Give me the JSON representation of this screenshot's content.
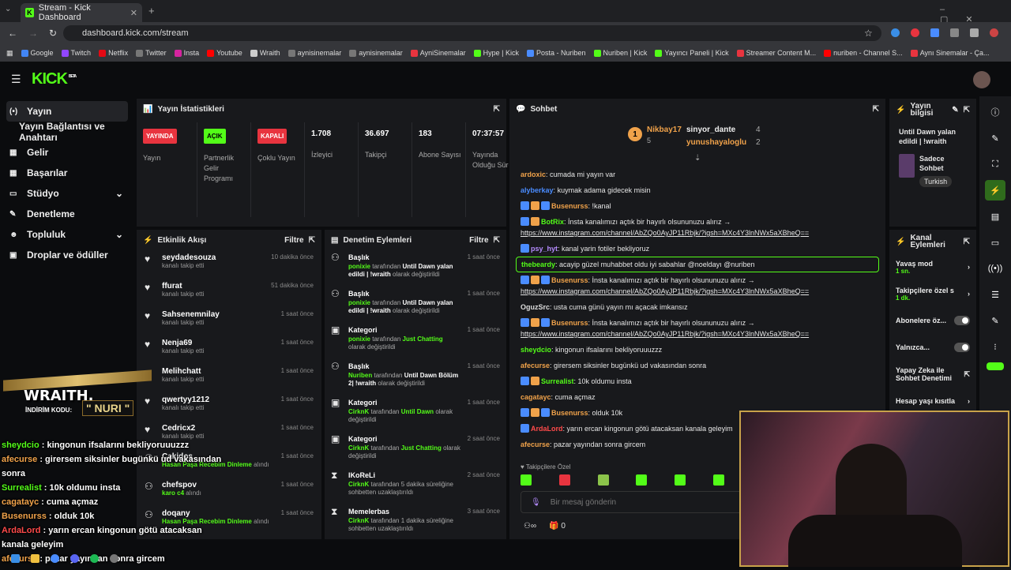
{
  "browser": {
    "tab_title": "Stream - Kick Dashboard",
    "url": "dashboard.kick.com/stream"
  },
  "bookmarks": [
    "Google",
    "Twitch",
    "Netflix",
    "Twitter",
    "Insta",
    "Youtube",
    "Wraith",
    "aynisinemalar",
    "aynisinemalar",
    "AyniSinemalar",
    "Hype | Kick",
    "Posta - Nuriben",
    "Nuriben | Kick",
    "Yayıncı Paneli | Kick",
    "Streamer Content M...",
    "nuriben - Channel S...",
    "Aynı Sinemalar - Ça..."
  ],
  "logo": "KICK",
  "logo_beta": "BETA",
  "sidebar": {
    "items": [
      {
        "label": "Yayın",
        "icon": "(•)"
      },
      {
        "label": "Yayın Bağlantısı ve Anahtarı",
        "icon": ""
      },
      {
        "label": "Gelir",
        "icon": "▦"
      },
      {
        "label": "Başarılar",
        "icon": "▦"
      },
      {
        "label": "Stüdyo",
        "icon": "▭"
      },
      {
        "label": "Denetleme",
        "icon": "✎"
      },
      {
        "label": "Topluluk",
        "icon": "☻"
      },
      {
        "label": "Droplar ve ödüller",
        "icon": "▣"
      }
    ]
  },
  "stats": {
    "title": "Yayın İstatistikleri",
    "cols": [
      {
        "badge": "YAYINDA",
        "label": "Yayın"
      },
      {
        "badge": "AÇIK",
        "label": "Partnerlik Gelir Programı"
      },
      {
        "badge": "KAPALI",
        "label": "Çoklu Yayın"
      },
      {
        "value": "1.708",
        "label": "İzleyici"
      },
      {
        "value": "36.697",
        "label": "Takipçi"
      },
      {
        "value": "183",
        "label": "Abone Sayısı"
      },
      {
        "value": "07:37:57",
        "label": "Yayında Olduğu Süre"
      }
    ]
  },
  "activity": {
    "title": "Etkinlik Akışı",
    "filter": "Filtre",
    "rows": [
      {
        "name": "seydadesouza",
        "sub": "kanalı takip etti",
        "time": "10 dakika önce"
      },
      {
        "name": "ffurat",
        "sub": "kanalı takip etti",
        "time": "51 dakika önce"
      },
      {
        "name": "Sahsenemnilay",
        "sub": "kanalı takip etti",
        "time": "1 saat önce"
      },
      {
        "name": "Nenja69",
        "sub": "kanalı takip etti",
        "time": "1 saat önce"
      },
      {
        "name": "Melihchatt",
        "sub": "kanalı takip etti",
        "time": "1 saat önce"
      },
      {
        "name": "qwertyy1212",
        "sub": "kanalı takip etti",
        "time": "1 saat önce"
      },
      {
        "name": "Cedricx2",
        "sub": "kanalı takip etti",
        "time": "1 saat önce"
      },
      {
        "name": "Cakidos",
        "sub": "Hasan Paşa Recebim Dinleme",
        "sub2": "alındı",
        "time": "1 saat önce"
      },
      {
        "name": "chefspov",
        "sub": "karo c4",
        "sub2": "alındı",
        "time": "1 saat önce"
      },
      {
        "name": "doqany",
        "sub": "Hasan Paşa Recebim Dinleme",
        "sub2": "alındı",
        "time": "1 saat önce"
      }
    ]
  },
  "mod": {
    "title": "Denetim Eylemleri",
    "filter": "Filtre",
    "rows": [
      {
        "title": "Başlık",
        "user": "ponixie",
        "mid": "tarafından",
        "val": "Until Dawn yalan edildi | !wraith",
        "end": "olarak değiştirildi",
        "time": "1 saat önce"
      },
      {
        "title": "Başlık",
        "user": "ponixie",
        "mid": "tarafından",
        "val": "Until Dawn yalan edildi | !wraith",
        "end": "olarak değiştirildi",
        "time": "1 saat önce"
      },
      {
        "title": "Kategori",
        "user": "ponixie",
        "mid": "tarafından",
        "val": "Just Chatting",
        "end": "olarak değiştirildi",
        "time": "1 saat önce"
      },
      {
        "title": "Başlık",
        "user": "Nuriben",
        "mid": "tarafından",
        "val": "Until Dawn Bölüm 2| !wraith",
        "end": "olarak değiştirildi",
        "time": "1 saat önce"
      },
      {
        "title": "Kategori",
        "user": "CirknK",
        "mid": "tarafından",
        "val": "Until Dawn",
        "end": "olarak değiştirildi",
        "time": "1 saat önce"
      },
      {
        "title": "Kategori",
        "user": "CirknK",
        "mid": "tarafından",
        "val": "Just Chatting",
        "end": "olarak değiştirildi",
        "time": "2 saat önce"
      },
      {
        "title": "IKoReLi",
        "user": "CirknK",
        "mid": "tarafından 5 dakika süreliğine sohbetten uzaklaştırıldı",
        "val": "",
        "end": "",
        "time": "2 saat önce"
      },
      {
        "title": "Memelerbas",
        "user": "CirknK",
        "mid": "tarafından 1 dakika süreliğine sohbetten uzaklaştırıldı",
        "val": "",
        "end": "",
        "time": "3 saat önce"
      },
      {
        "title": "Başlık",
        "user": "",
        "mid": "",
        "val": "",
        "end": "",
        "time": "3 saat önce"
      }
    ]
  },
  "chat": {
    "title": "Sohbet",
    "top": [
      {
        "name": "Nikbay17",
        "count": "5"
      },
      {
        "name": "sinyor_dante",
        "count": "4"
      },
      {
        "name": "yunushayaloglu",
        "count": "2"
      }
    ],
    "messages": [
      {
        "user": "ardoxic",
        "color": "#f0a24a",
        "text": "cumada mi yayın var"
      },
      {
        "user": "alyberkay",
        "color": "#4a8cff",
        "text": "kuymak adama gidecek misin"
      },
      {
        "user": "Busenurss",
        "color": "#f0a24a",
        "text": "!kanal",
        "badges": 3
      },
      {
        "user": "BotRix",
        "color": "#53fc18",
        "text": "İnsta kanalımızı açtık bir hayırlı olsununuzu alırız →",
        "link": "https://www.instagram.com/channel/AbZQo0AyJP11Rbjk/?igsh=MXc4Y3lnNWx5aXBheQ==",
        "badges": 2
      },
      {
        "user": "psy_hyt",
        "color": "#b58cff",
        "text": "kanal yarin fotiler bekliyoruz",
        "badges": 1
      },
      {
        "user": "thebeardy",
        "color": "#53fc18",
        "text": "acayip güzel muhabbet oldu iyi sabahlar @noeldayı @nuriben",
        "hl": true
      },
      {
        "user": "Busenurss",
        "color": "#f0a24a",
        "text": "İnsta kanalımızı açtık bir hayırlı olsununuzu alırız →",
        "link": "https://www.instagram.com/channel/AbZQo0AyJP11Rbjk/?igsh=MXc4Y3lnNWx5aXBheQ==",
        "badges": 3
      },
      {
        "user": "OguzSrc",
        "color": "#dddddd",
        "text": "usta cuma günü yayın mı açacak imkansız"
      },
      {
        "user": "Busenurss",
        "color": "#f0a24a",
        "text": "İnsta kanalımızı açtık bir hayırlı olsununuzu alırız →",
        "link": "https://www.instagram.com/channel/AbZQo0AyJP11Rbjk/?igsh=MXc4Y3lnNWx5aXBheQ==",
        "badges": 3
      },
      {
        "user": "sheydcio",
        "color": "#53fc18",
        "text": "kingonun ifsalarını bekliyoruuuzzz"
      },
      {
        "user": "afecurse",
        "color": "#f0a24a",
        "text": "girersem siksinler bugünkü ud vakasından sonra"
      },
      {
        "user": "Surrealist",
        "color": "#53fc18",
        "text": "10k oldumu insta",
        "badges": 2
      },
      {
        "user": "cagatayc",
        "color": "#f0a24a",
        "text": "cuma açmaz"
      },
      {
        "user": "Busenurss",
        "color": "#f0a24a",
        "text": "olduk 10k",
        "badges": 3
      },
      {
        "user": "ArdaLord",
        "color": "#ff4a4a",
        "text": "yarın ercan kingonun götü atacaksan kanala geleyim",
        "badges": 1
      },
      {
        "user": "afecurse",
        "color": "#f0a24a",
        "text": "pazar yayından sonra gircem"
      }
    ],
    "followers_only": "Takipçilere Özel",
    "placeholder": "Bir mesaj gönderin",
    "count": "0"
  },
  "info": {
    "title": "Yayın bilgisi",
    "stream_title": "Until Dawn yalan edildi | !wraith",
    "category": "Sadece Sohbet",
    "lang": "Turkish"
  },
  "modpanel": {
    "title": "Kanal Eylemleri",
    "items": [
      {
        "label": "Yavaş mod",
        "sub": "1 sn."
      },
      {
        "label": "Takipçilere özel s",
        "sub": "1 dk."
      },
      {
        "label": "Abonelere öz..."
      },
      {
        "label": "Yalnızca..."
      },
      {
        "label": "Yapay Zeka ile Sohbet Denetimi"
      },
      {
        "label": "Hesap yaşı kısıtla"
      },
      {
        "label": "Yasaklanmış kelin"
      }
    ]
  },
  "overlay": {
    "brand": "WRAITH.",
    "code_label": "İNDİRİM KODU:",
    "code": "\" NURI \"",
    "lines": [
      {
        "user": "sheydcio",
        "color": "#53fc18",
        "text": "kingonun ifsalarını bekliyoruuuzzz"
      },
      {
        "user": "afecurse",
        "color": "#f0a24a",
        "text": "girersem siksinler bugünkü ud vakasından"
      },
      {
        "user": "",
        "color": "#ffffff",
        "text": "sonra"
      },
      {
        "user": "Surrealist",
        "color": "#53fc18",
        "text": "10k oldumu insta"
      },
      {
        "user": "cagatayc",
        "color": "#f0a24a",
        "text": "cuma açmaz"
      },
      {
        "user": "Busenurss",
        "color": "#f0a24a",
        "text": "olduk 10k"
      },
      {
        "user": "ArdaLord",
        "color": "#ff4a4a",
        "text": "yarın ercan kingonun götü atacaksan"
      },
      {
        "user": "",
        "color": "#ffffff",
        "text": "kanala geleyim"
      },
      {
        "user": "afecurse",
        "color": "#f0a24a",
        "text": "pazar yayından sonra gircem"
      }
    ]
  },
  "colors": {
    "accent": "#53fc18",
    "live": "#e8343f",
    "panel": "#18191c"
  }
}
